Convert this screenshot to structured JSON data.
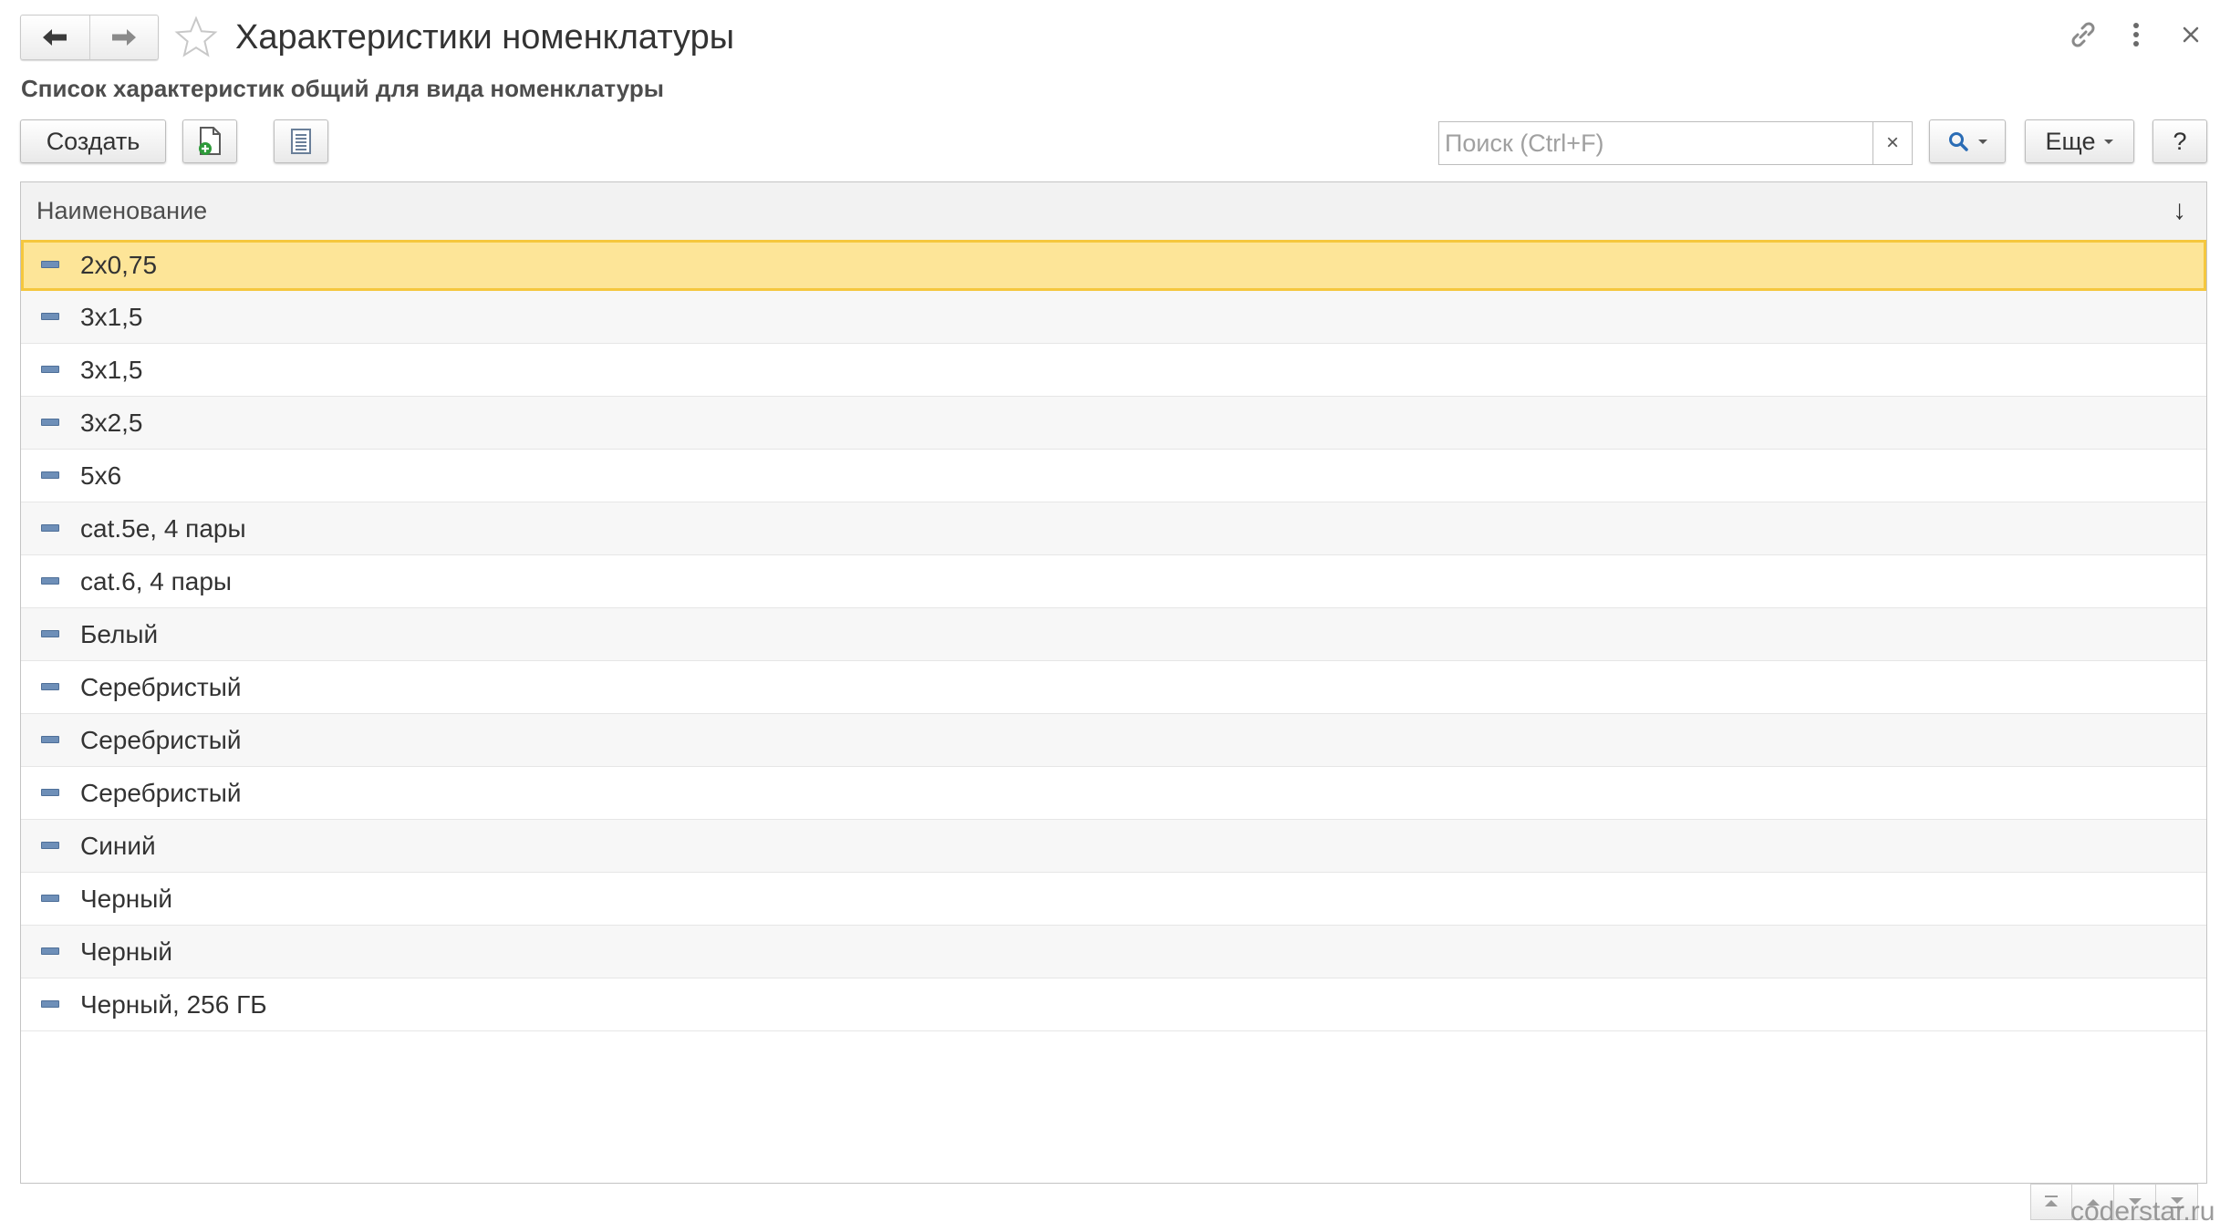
{
  "header": {
    "title": "Характеристики номенклатуры",
    "subtitle": "Список характеристик общий для вида номенклатуры",
    "back_icon": "arrow-left-icon",
    "forward_icon": "arrow-right-icon",
    "favorite_icon": "star-icon",
    "link_icon": "link-icon",
    "more_icon": "kebab-menu-icon",
    "close_icon": "close-icon"
  },
  "toolbar": {
    "create_label": "Создать",
    "create_copy_icon": "document-add-icon",
    "list_mode_icon": "list-icon",
    "search_placeholder": "Поиск (Ctrl+F)",
    "search_value": "",
    "search_clear_label": "×",
    "search_button_icon": "magnifier-icon",
    "more_label": "Еще",
    "help_label": "?"
  },
  "table": {
    "columns": [
      "Наименование"
    ],
    "sort_indicator": "↓",
    "selected_index": 0,
    "rows": [
      "2х0,75",
      "3х1,5",
      "3х1,5",
      "3х2,5",
      "5х6",
      "cat.5e, 4 пары",
      "cat.6, 4 пары",
      "Белый",
      "Серебристый",
      "Серебристый",
      "Серебристый",
      "Синий",
      "Черный",
      "Черный",
      "Черный, 256 ГБ"
    ]
  },
  "footer": {
    "scroll_icons": [
      "scroll-to-top-icon",
      "scroll-up-icon",
      "scroll-down-icon",
      "scroll-to-bottom-icon"
    ]
  },
  "watermark": "coderstar.ru",
  "colors": {
    "selected_row_bg": "#fde598",
    "selected_row_border": "#f5c73e",
    "row_icon": "#6e8fb8",
    "search_icon": "#2a6cb5",
    "add_icon": "#2e9a3a"
  }
}
